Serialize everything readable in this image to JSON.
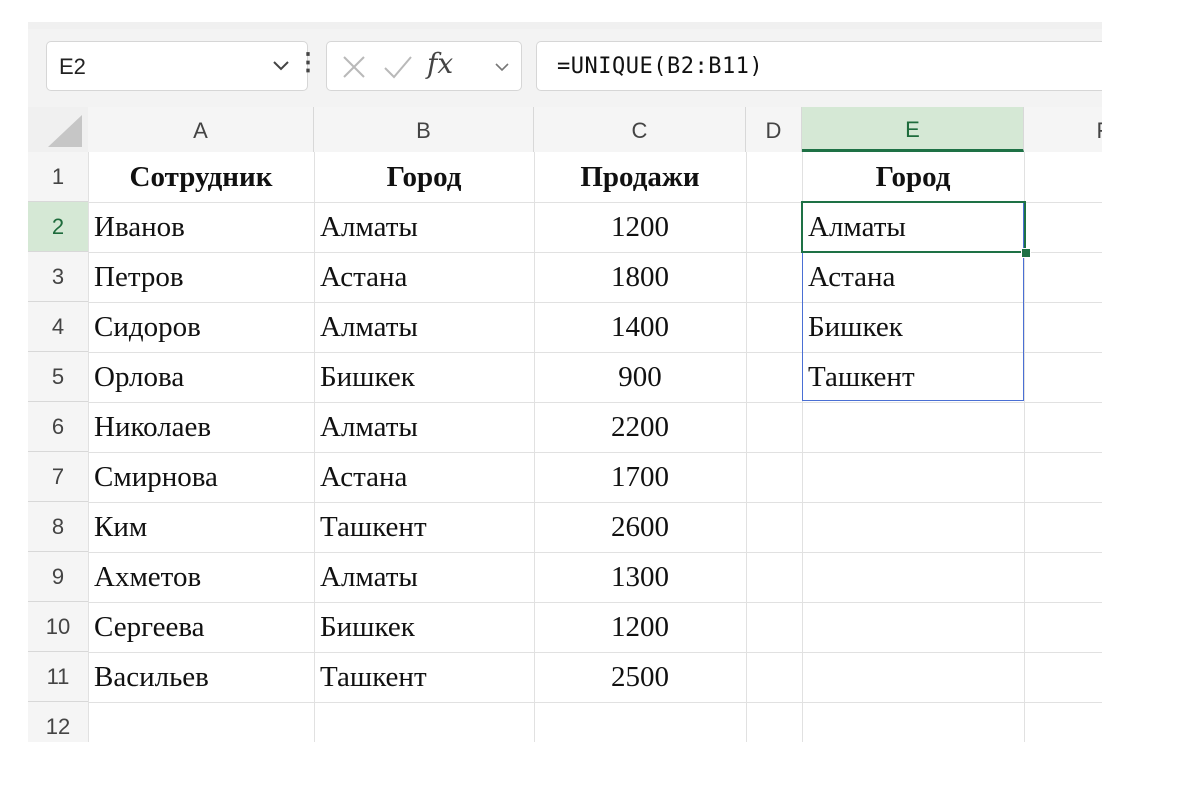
{
  "formula_bar": {
    "name_box": "E2",
    "fx_label": "fx",
    "formula": "=UNIQUE(B2:B11)"
  },
  "columns": [
    "A",
    "B",
    "C",
    "D",
    "E",
    "F"
  ],
  "selected_column": "E",
  "rows": [
    "1",
    "2",
    "3",
    "4",
    "5",
    "6",
    "7",
    "8",
    "9",
    "10",
    "11",
    "12"
  ],
  "selected_row": "2",
  "headers": {
    "a": "Сотрудник",
    "b": "Город",
    "c": "Продажи",
    "e": "Город"
  },
  "table": [
    {
      "employee": "Иванов",
      "city": "Алматы",
      "sales": "1200"
    },
    {
      "employee": "Петров",
      "city": "Астана",
      "sales": "1800"
    },
    {
      "employee": "Сидоров",
      "city": "Алматы",
      "sales": "1400"
    },
    {
      "employee": "Орлова",
      "city": "Бишкек",
      "sales": "900"
    },
    {
      "employee": "Николаев",
      "city": "Алматы",
      "sales": "2200"
    },
    {
      "employee": "Смирнова",
      "city": "Астана",
      "sales": "1700"
    },
    {
      "employee": "Ким",
      "city": "Ташкент",
      "sales": "2600"
    },
    {
      "employee": "Ахметов",
      "city": "Алматы",
      "sales": "1300"
    },
    {
      "employee": "Сергеева",
      "city": "Бишкек",
      "sales": "1200"
    },
    {
      "employee": "Васильев",
      "city": "Ташкент",
      "sales": "2500"
    }
  ],
  "unique_cities": [
    "Алматы",
    "Астана",
    "Бишкек",
    "Ташкент"
  ],
  "colors": {
    "accent_green": "#1e7145",
    "selected_header_bg": "#d5e8d5",
    "spill_border": "#4a6fd4"
  }
}
